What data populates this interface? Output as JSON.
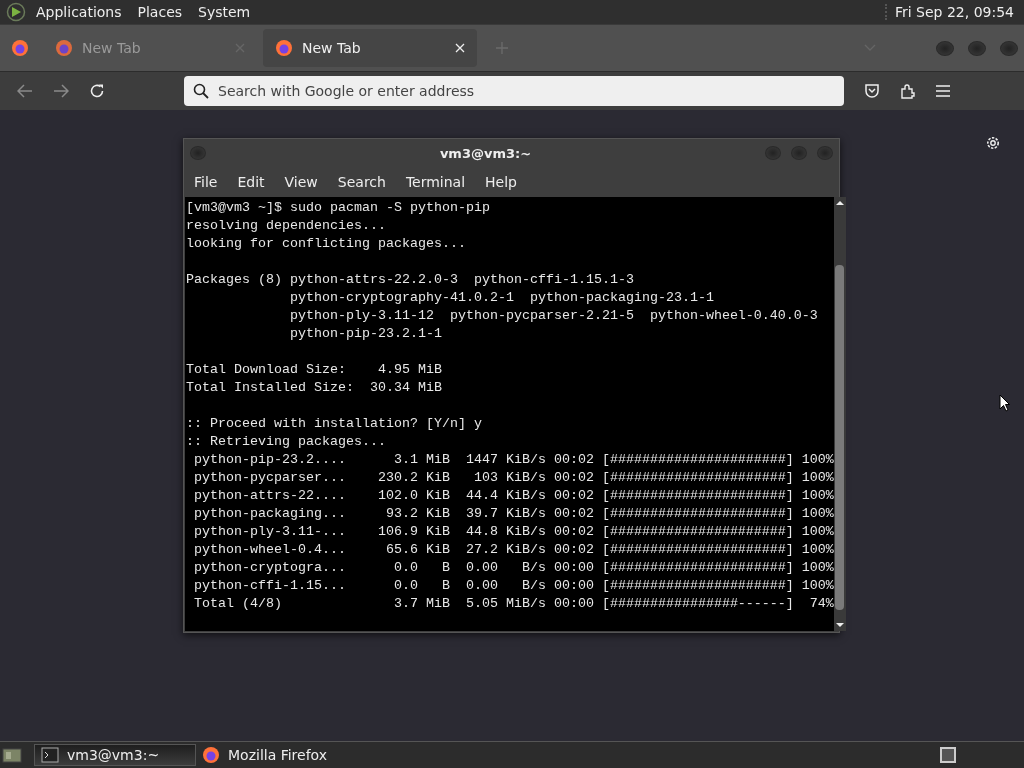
{
  "top_panel": {
    "menus": [
      "Applications",
      "Places",
      "System"
    ],
    "clock": "Fri Sep 22, 09:54"
  },
  "browser": {
    "tabs": [
      {
        "label": "New Tab",
        "selected": false
      },
      {
        "label": "New Tab",
        "selected": true
      }
    ],
    "address_bar": {
      "placeholder": "Search with Google or enter address"
    }
  },
  "terminal": {
    "title": "vm3@vm3:~",
    "menus": [
      "File",
      "Edit",
      "View",
      "Search",
      "Terminal",
      "Help"
    ],
    "blocks": [
      [
        "[vm3@vm3 ~]$ sudo pacman -S python-pip",
        "resolving dependencies...",
        "looking for conflicting packages..."
      ],
      [
        "Packages (8) python-attrs-22.2.0-3  python-cffi-1.15.1-3",
        "             python-cryptography-41.0.2-1  python-packaging-23.1-1",
        "             python-ply-3.11-12  python-pycparser-2.21-5  python-wheel-0.40.0-3",
        "             python-pip-23.2.1-1"
      ],
      [
        "Total Download Size:    4.95 MiB",
        "Total Installed Size:  30.34 MiB"
      ],
      [
        ":: Proceed with installation? [Y/n] y",
        ":: Retrieving packages...",
        " python-pip-23.2....      3.1 MiB  1447 KiB/s 00:02 [######################] 100%",
        " python-pycparser...    230.2 KiB   103 KiB/s 00:02 [######################] 100%",
        " python-attrs-22....    102.0 KiB  44.4 KiB/s 00:02 [######################] 100%",
        " python-packaging...     93.2 KiB  39.7 KiB/s 00:02 [######################] 100%",
        " python-ply-3.11-...    106.9 KiB  44.8 KiB/s 00:02 [######################] 100%",
        " python-wheel-0.4...     65.6 KiB  27.2 KiB/s 00:02 [######################] 100%",
        " python-cryptogra...      0.0   B  0.00   B/s 00:00 [######################] 100%",
        " python-cffi-1.15...      0.0   B  0.00   B/s 00:00 [######################] 100%",
        " Total (4/8)              3.7 MiB  5.05 MiB/s 00:00 [################------]  74%"
      ]
    ]
  },
  "taskbar": {
    "tasks": [
      {
        "label": "vm3@vm3:~",
        "selected": true,
        "kind": "terminal"
      },
      {
        "label": "Mozilla Firefox",
        "selected": false,
        "kind": "browser"
      }
    ]
  }
}
